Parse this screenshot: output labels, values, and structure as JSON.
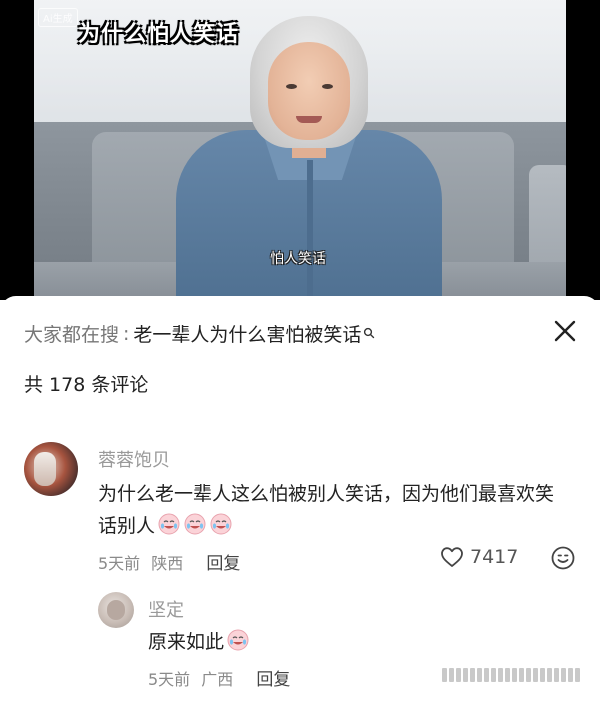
{
  "video": {
    "badge": "Ai生成",
    "top_caption": "为什么怕人笑话",
    "subtitle": "怕人笑话"
  },
  "search": {
    "prefix": "大家都在搜",
    "colon": ":",
    "term": "老一辈人为什么害怕被笑话"
  },
  "comments_count": "共 178 条评论",
  "comments": [
    {
      "username": "蓉蓉饱贝",
      "text": "为什么老一辈人这么怕被别人笑话，因为他们最喜欢笑话别人",
      "emoji_count": 3,
      "time": "5天前",
      "region": "陕西",
      "reply_label": "回复",
      "likes": "7417"
    },
    {
      "username": "坚定",
      "text": "原来如此",
      "emoji_count": 1,
      "time": "5天前",
      "region": "广西",
      "reply_label": "回复"
    }
  ],
  "icons": {
    "close": "close-icon",
    "search": "search-icon",
    "like": "heart-icon",
    "more": "smiley-icon"
  }
}
